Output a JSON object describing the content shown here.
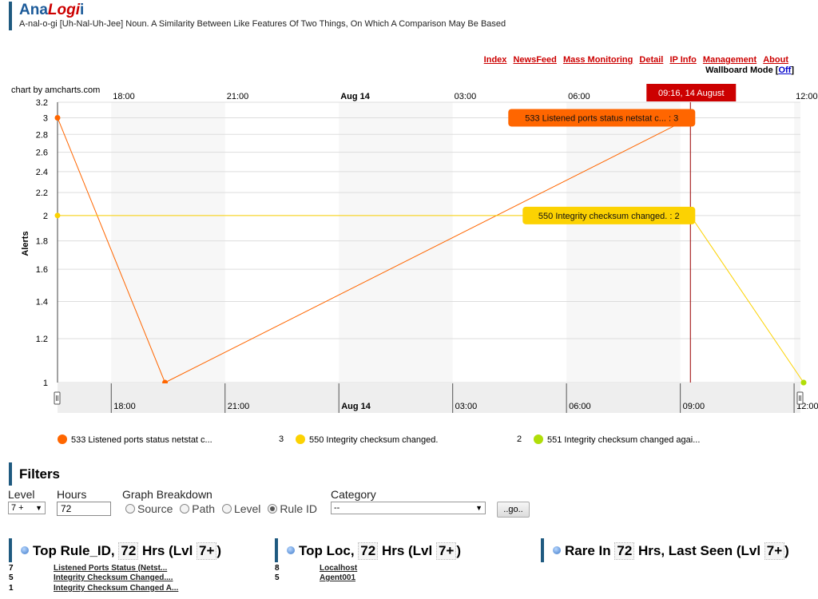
{
  "header": {
    "title_part1": "Ana",
    "title_part2": "Logi",
    "title_part3": "i",
    "tagline": "A-nal-o-gi [Uh-Nal-Uh-Jee] Noun. A Similarity Between Like Features Of Two Things, On Which A Comparison May Be Based"
  },
  "nav": {
    "links": [
      "Index",
      "NewsFeed",
      "Mass Monitoring",
      "Detail",
      "IP Info",
      "Management",
      "About"
    ],
    "wallboard_label": "Wallboard Mode [",
    "wallboard_link": "Off",
    "wallboard_suffix": "]"
  },
  "chart_credit": "chart by amcharts.com",
  "chart_data": {
    "type": "line",
    "ylabel": "Alerts",
    "ylim": [
      1,
      3.2
    ],
    "y_scale": "log",
    "y_ticks": [
      "1",
      "1.2",
      "1.4",
      "1.6",
      "1.8",
      "2",
      "2.2",
      "2.4",
      "2.6",
      "2.8",
      "3",
      "3.2"
    ],
    "x_tick_labels": [
      "18:00",
      "21:00",
      "Aug 14",
      "03:00",
      "06:00",
      "09:00",
      "12:00"
    ],
    "cursor_label": "09:16, 14 August",
    "grid": true,
    "series": [
      {
        "name": "533 Listened ports status netstat c...",
        "color": "#ff6600",
        "points": [
          {
            "x": "Aug 13 16:35",
            "y": 3
          },
          {
            "x": "Aug 13 19:25",
            "y": 1
          },
          {
            "x": "Aug 14 09:16",
            "y": 3
          }
        ]
      },
      {
        "name": "550 Integrity checksum changed.",
        "color": "#fcd202",
        "points": [
          {
            "x": "Aug 13 16:35",
            "y": 2
          },
          {
            "x": "Aug 14 09:16",
            "y": 2
          },
          {
            "x": "Aug 14 12:15",
            "y": 1
          }
        ]
      },
      {
        "name": "551 Integrity checksum changed agai...",
        "color": "#b0de09",
        "points": [
          {
            "x": "Aug 14 12:15",
            "y": 1
          }
        ]
      }
    ],
    "balloons": [
      {
        "text": "533 Listened ports status netstat c... : 3",
        "color": "#ff6600"
      },
      {
        "text": "550 Integrity checksum changed. : 2",
        "color": "#fcd202"
      }
    ]
  },
  "legend": {
    "items": [
      {
        "label": "533 Listened ports status netstat c...",
        "value": "3",
        "color": "#ff6600"
      },
      {
        "label": "550 Integrity checksum changed.",
        "value": "2",
        "color": "#fcd202"
      },
      {
        "label": "551 Integrity checksum changed agai...",
        "value": "",
        "color": "#b0de09"
      }
    ]
  },
  "filters": {
    "title": "Filters",
    "level_label": "Level",
    "level_value": "7 +",
    "hours_label": "Hours",
    "hours_value": "72",
    "breakdown_label": "Graph Breakdown",
    "breakdown_options": [
      "Source",
      "Path",
      "Level",
      "Rule ID"
    ],
    "breakdown_selected": 3,
    "category_label": "Category",
    "category_value": "--",
    "go_label": "..go.."
  },
  "panels": {
    "top_rule": {
      "title_a": "Top Rule_ID, ",
      "hours": "72",
      "title_b": " Hrs (Lvl ",
      "level": "7+",
      "title_c": ")",
      "rows": [
        {
          "count": "7",
          "label": "Listened Ports Status (Netst..."
        },
        {
          "count": "5",
          "label": "Integrity Checksum Changed...."
        },
        {
          "count": "1",
          "label": "Integrity Checksum Changed A..."
        }
      ]
    },
    "top_loc": {
      "title_a": "Top Loc, ",
      "hours": "72",
      "title_b": " Hrs (Lvl ",
      "level": "7+",
      "title_c": ")",
      "rows": [
        {
          "count": "8",
          "label": "Localhost"
        },
        {
          "count": "5",
          "label": "Agent001"
        }
      ]
    },
    "rare": {
      "title_a": "Rare In ",
      "hours": "72",
      "title_b": " Hrs, Last Seen (Lvl ",
      "level": "7+",
      "title_c": ")"
    }
  }
}
